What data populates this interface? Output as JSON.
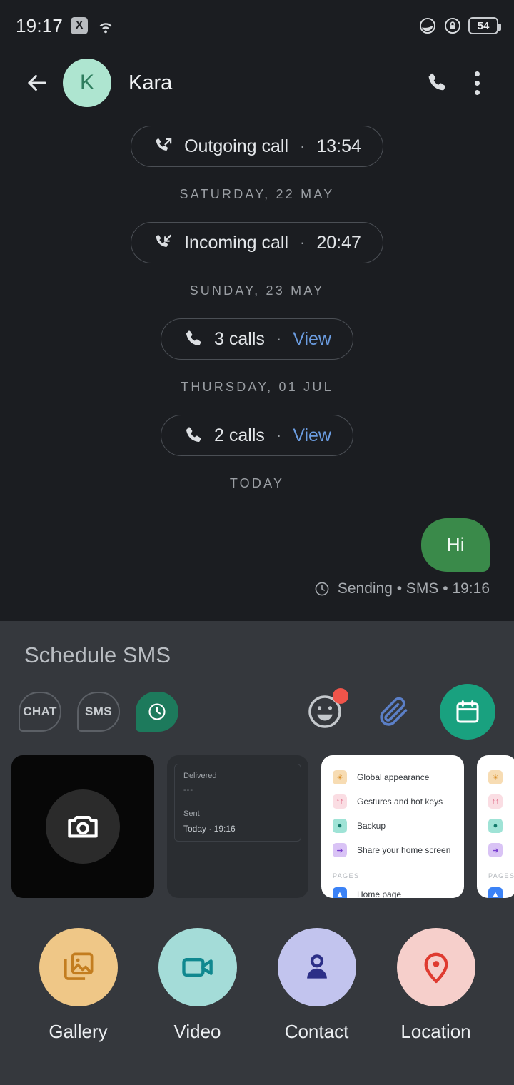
{
  "status_bar": {
    "time": "19:17",
    "x_badge": "X",
    "wifi_icon": "wifi-icon",
    "dnd_icon": "do-not-disturb-icon",
    "lock_icon": "rotation-lock-icon",
    "battery_level": "54"
  },
  "app_bar": {
    "back_icon": "arrow-left-icon",
    "avatar_initial": "K",
    "avatar_color": "#aee5d0",
    "contact_name": "Kara",
    "call_icon": "phone-icon",
    "overflow_icon": "more-vertical-icon"
  },
  "chat": {
    "entries": [
      {
        "kind": "call-chip",
        "icon": "call-outgoing-icon",
        "label": "Outgoing call",
        "separator": "·",
        "value": "13:54"
      },
      {
        "kind": "date",
        "label": "SATURDAY, 22 MAY"
      },
      {
        "kind": "call-chip",
        "icon": "call-incoming-icon",
        "label": "Incoming call",
        "separator": "·",
        "value": "20:47"
      },
      {
        "kind": "date",
        "label": "SUNDAY, 23 MAY"
      },
      {
        "kind": "call-chip",
        "icon": "phone-icon",
        "label": "3 calls",
        "separator": "·",
        "value": "View",
        "link": true
      },
      {
        "kind": "date",
        "label": "THURSDAY, 01 JUL"
      },
      {
        "kind": "call-chip",
        "icon": "phone-icon",
        "label": "2 calls",
        "separator": "·",
        "value": "View",
        "link": true
      },
      {
        "kind": "date",
        "label": "TODAY"
      }
    ],
    "message": {
      "text": "Hi",
      "bubble_color": "#3a8a4a",
      "status_icon": "clock-icon",
      "status_text": "Sending • SMS • 19:16"
    }
  },
  "attach_panel": {
    "title": "Schedule SMS",
    "modes": [
      {
        "label": "CHAT",
        "name": "mode-chat",
        "selected": false
      },
      {
        "label": "SMS",
        "name": "mode-sms",
        "selected": false
      },
      {
        "label": "",
        "name": "mode-schedule",
        "selected": true,
        "icon": "clock-icon"
      }
    ],
    "actions": {
      "emoji_icon": "emoji-icon",
      "emoji_badge": true,
      "attach_icon": "paperclip-icon",
      "schedule_icon": "calendar-icon",
      "schedule_bg": "#19a17f"
    },
    "thumbnails": [
      {
        "type": "camera",
        "icon": "camera-icon",
        "name": "thumbnail-camera"
      },
      {
        "type": "screenshot-dark",
        "name": "thumbnail-screenshot-dark",
        "lines": {
          "delivered_label": "Delivered",
          "delivered_value": "---",
          "sent_label": "Sent",
          "sent_value": "Today · 19:16"
        }
      },
      {
        "type": "screenshot-light",
        "name": "thumbnail-screenshot-settings",
        "rows": [
          {
            "label": "Global appearance",
            "icon": "appearance-icon",
            "color": "#f3c27a"
          },
          {
            "label": "Gestures and hot keys",
            "icon": "gestures-icon",
            "color": "#f2a3b4"
          },
          {
            "label": "Backup",
            "icon": "backup-icon",
            "color": "#55c9b4"
          },
          {
            "label": "Share your home screen",
            "icon": "share-icon",
            "color": "#9b6bea"
          }
        ],
        "section": "PAGES",
        "footer_row": {
          "label": "Home page",
          "icon": "home-icon",
          "color": "#3b82f6"
        }
      },
      {
        "type": "screenshot-light-clipped",
        "name": "thumbnail-screenshot-settings-partial"
      }
    ],
    "quick_actions": [
      {
        "label": "Gallery",
        "icon": "gallery-icon",
        "bg": "#efc787",
        "fg": "#c37d1f",
        "name": "quick-action-gallery"
      },
      {
        "label": "Video",
        "icon": "video-icon",
        "bg": "#a4dcd8",
        "fg": "#10888f",
        "name": "quick-action-video"
      },
      {
        "label": "Contact",
        "icon": "contact-icon",
        "bg": "#c2c4ee",
        "fg": "#2c2f87",
        "name": "quick-action-contact"
      },
      {
        "label": "Location",
        "icon": "location-icon",
        "bg": "#f6cfcb",
        "fg": "#df3b30",
        "name": "quick-action-location"
      }
    ]
  }
}
